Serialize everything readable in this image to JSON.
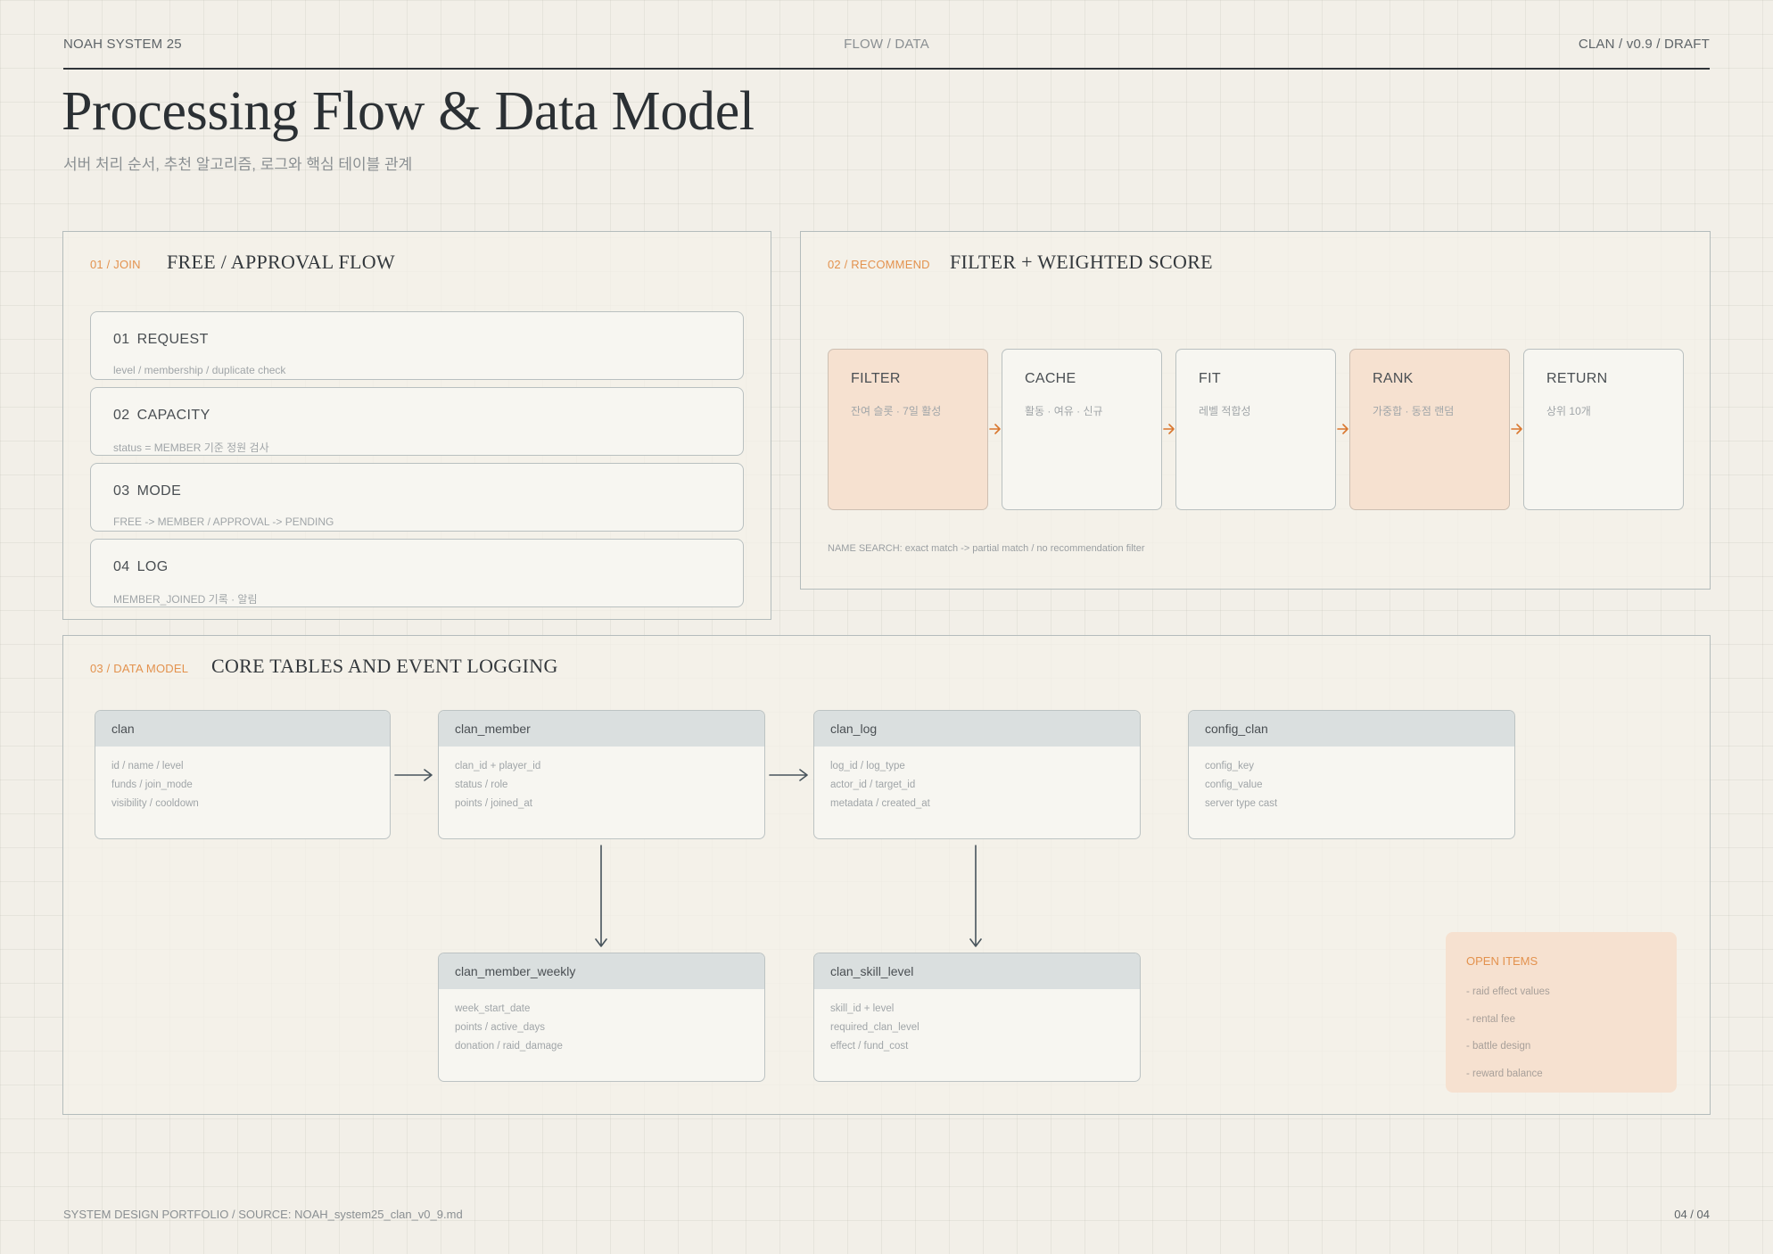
{
  "header": {
    "left": "NOAH SYSTEM 25",
    "center": "FLOW / DATA",
    "right": "CLAN / v0.9 / DRAFT"
  },
  "page": {
    "title": "Processing Flow & Data Model",
    "subtitle": "서버 처리 순서, 추천 알고리즘, 로그와 핵심 테이블 관계"
  },
  "join": {
    "tag": "01 / JOIN",
    "title": "FREE / APPROVAL FLOW",
    "steps": [
      {
        "num": "01",
        "label": "REQUEST",
        "desc": "level / membership / duplicate check"
      },
      {
        "num": "02",
        "label": "CAPACITY",
        "desc": "status = MEMBER 기준 정원 검사"
      },
      {
        "num": "03",
        "label": "MODE",
        "desc": "FREE -> MEMBER / APPROVAL -> PENDING"
      },
      {
        "num": "04",
        "label": "LOG",
        "desc": "MEMBER_JOINED 기록 · 알림"
      }
    ]
  },
  "recommend": {
    "tag": "02 / RECOMMEND",
    "title": "FILTER + WEIGHTED SCORE",
    "stages": [
      {
        "label": "FILTER",
        "desc": "잔여 슬롯 · 7일 활성",
        "highlight": true
      },
      {
        "label": "CACHE",
        "desc": "활동 · 여유 · 신규",
        "highlight": false
      },
      {
        "label": "FIT",
        "desc": "레벨 적합성",
        "highlight": false
      },
      {
        "label": "RANK",
        "desc": "가중합 · 동점 랜덤",
        "highlight": true
      },
      {
        "label": "RETURN",
        "desc": "상위 10개",
        "highlight": false
      }
    ],
    "arrow_color": "#d9772f",
    "note": "NAME SEARCH: exact match -> partial match / no recommendation filter"
  },
  "datamodel": {
    "tag": "03 / DATA MODEL",
    "title": "CORE TABLES AND EVENT LOGGING",
    "tables": {
      "clan": {
        "name": "clan",
        "fields": [
          "id / name / level",
          "funds / join_mode",
          "visibility / cooldown"
        ]
      },
      "clan_member": {
        "name": "clan_member",
        "fields": [
          "clan_id + player_id",
          "status / role",
          "points / joined_at"
        ]
      },
      "clan_log": {
        "name": "clan_log",
        "fields": [
          "log_id / log_type",
          "actor_id / target_id",
          "metadata / created_at"
        ]
      },
      "config_clan": {
        "name": "config_clan",
        "fields": [
          "config_key",
          "config_value",
          "server type cast"
        ]
      },
      "clan_member_weekly": {
        "name": "clan_member_weekly",
        "fields": [
          "week_start_date",
          "points / active_days",
          "donation / raid_damage"
        ]
      },
      "clan_skill_level": {
        "name": "clan_skill_level",
        "fields": [
          "skill_id + level",
          "required_clan_level",
          "effect / fund_cost"
        ]
      }
    },
    "open_items": {
      "title": "OPEN ITEMS",
      "items": [
        "- raid effect values",
        "- rental fee",
        "- battle design",
        "- reward balance"
      ]
    }
  },
  "footer": {
    "left": "SYSTEM DESIGN PORTFOLIO / SOURCE: NOAH_system25_clan_v0_9.md",
    "right": "04 / 04"
  }
}
